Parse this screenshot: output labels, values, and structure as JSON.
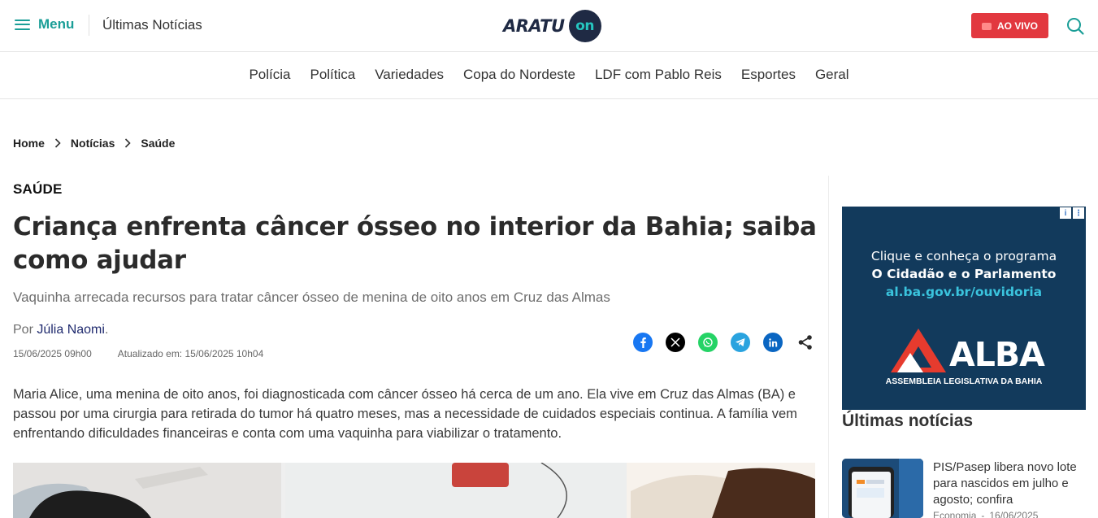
{
  "header": {
    "menu_label": "Menu",
    "latest_label": "Últimas Notícias",
    "logo_text": "ARATU",
    "logo_circle_text": "on",
    "live_label": "AO VIVO",
    "accent_color": "#1a9e97",
    "live_color": "#e2383f"
  },
  "nav": {
    "items": [
      "Polícia",
      "Política",
      "Variedades",
      "Copa do Nordeste",
      "LDF com Pablo Reis",
      "Esportes",
      "Geral"
    ]
  },
  "breadcrumb": {
    "items": [
      "Home",
      "Notícias",
      "Saúde"
    ]
  },
  "article": {
    "section": "SAÚDE",
    "title": "Criança enfrenta câncer ósseo no interior da Bahia; saiba como ajudar",
    "subtitle": "Vaquinha arrecada recursos para tratar câncer ósseo de menina de oito anos em Cruz das Almas",
    "byline_prefix": "Por ",
    "author": "Júlia Naomi",
    "byline_suffix": ".",
    "published": "15/06/2025 09h00",
    "updated": "Atualizado em: 15/06/2025 10h04",
    "body": "Maria Alice, uma menina de oito anos, foi diagnosticada com câncer ósseo há cerca de um ano. Ela vive em Cruz das Almas (BA) e passou por uma cirurgia para retirada do tumor há quatro meses, mas a necessidade de cuidados especiais continua. A família vem enfrentando dificuldades financeiras e conta com uma vaquinha para viabilizar o tratamento.",
    "share_icons": [
      "facebook-icon",
      "x-icon",
      "whatsapp-icon",
      "telegram-icon",
      "linkedin-icon",
      "share-icon"
    ]
  },
  "ad": {
    "line1": "Clique e conheça o programa",
    "line2": "O Cidadão e o Parlamento",
    "line3": "al.ba.gov.br/ouvidoria",
    "brand": "ALBA",
    "caption": "ASSEMBLEIA LEGISLATIVA DA BAHIA",
    "background": "#123a5c"
  },
  "sidebar": {
    "title": "Últimas notícias",
    "news": [
      {
        "title": "PIS/Pasep libera novo lote para nascidos em julho e agosto; confira",
        "category": "Economia",
        "separator": "-",
        "date": "16/06/2025"
      }
    ]
  }
}
